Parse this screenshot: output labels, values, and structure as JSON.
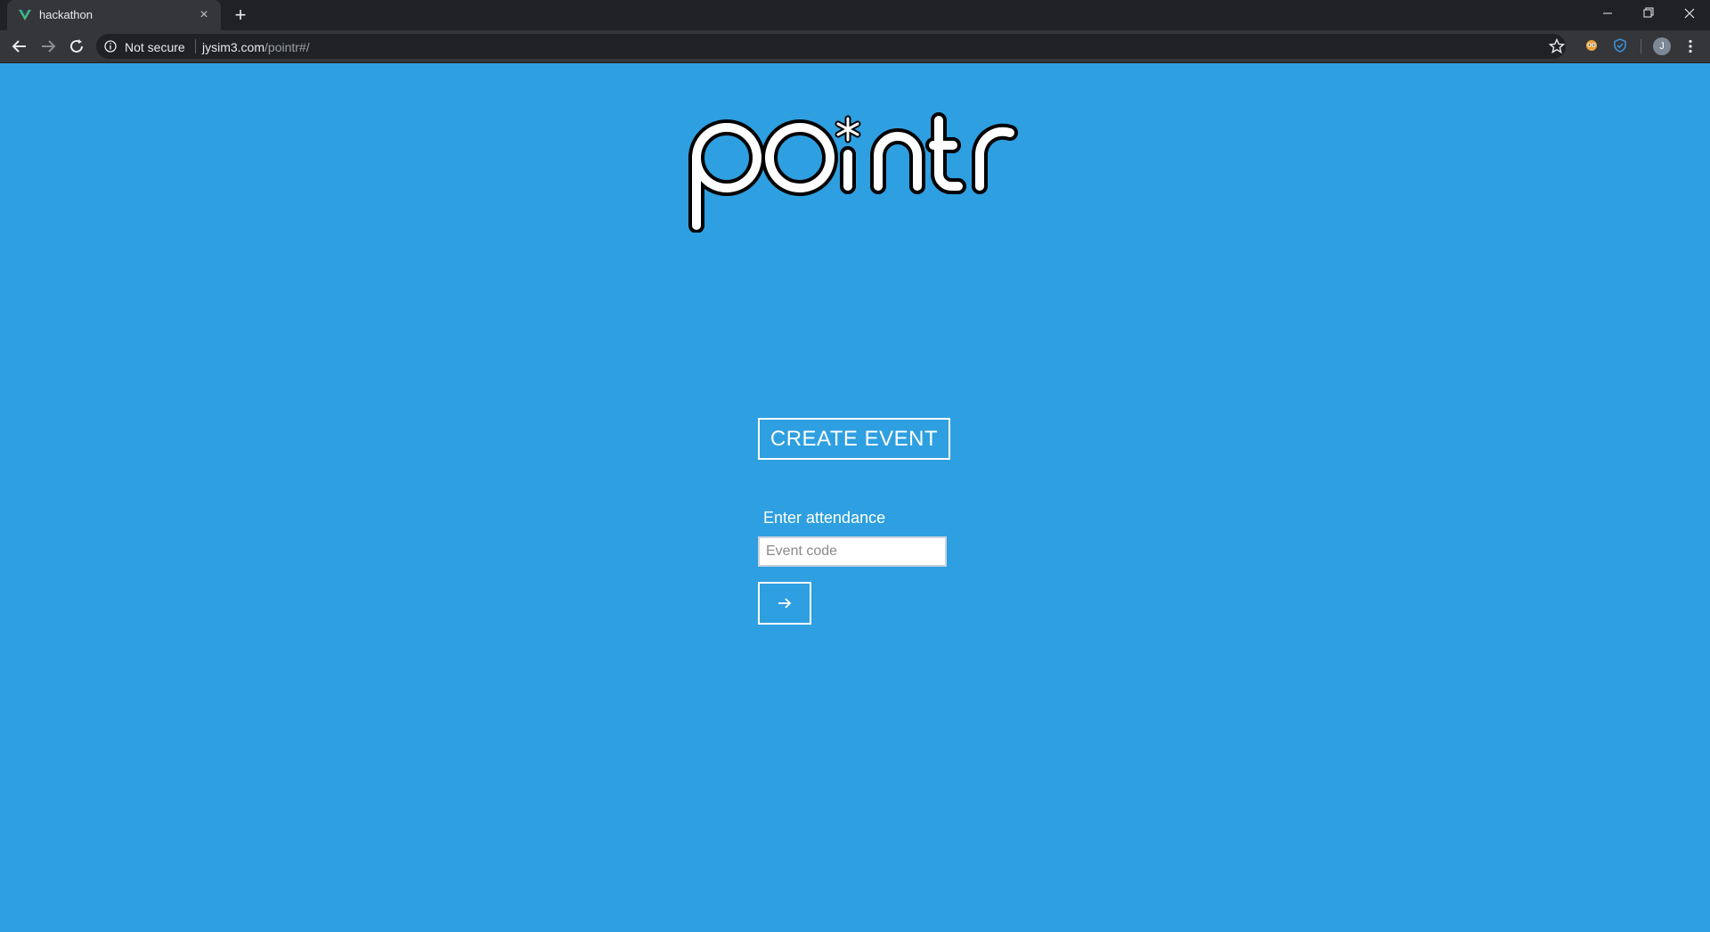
{
  "browser": {
    "tab": {
      "title": "hackathon",
      "favicon": "vue-logo-icon"
    },
    "address": {
      "security_label": "Not secure",
      "host": "jysim3.com",
      "path": "/pointr#/"
    },
    "avatar_letter": "J"
  },
  "page": {
    "logo_text": "pointr",
    "create_event_label": "CREATE EVENT",
    "attendance_label": "Enter attendance",
    "event_code_placeholder": "Event code",
    "submit_icon": "arrow-right-icon"
  },
  "colors": {
    "background": "#2e9fe0",
    "button_border": "#ffffff",
    "logo_fill": "#ffffff",
    "logo_stroke": "#000000"
  }
}
